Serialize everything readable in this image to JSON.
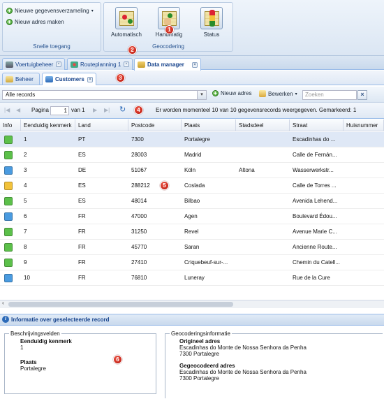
{
  "ribbon": {
    "quick_access": {
      "new_dataset_label": "Nieuwe gegevensverzameling",
      "new_address_label": "Nieuw adres maken",
      "group_label": "Snelle toegang"
    },
    "geocoding": {
      "automatic_label": "Automatisch",
      "manual_label": "Handmatig",
      "status_label": "Status",
      "group_label": "Geocodering"
    }
  },
  "tabs": [
    {
      "label": "Voertuigbeheer"
    },
    {
      "label": "Routeplanning 1"
    },
    {
      "label": "Data manager"
    }
  ],
  "subtabs": [
    {
      "label": "Beheer"
    },
    {
      "label": "Customers"
    }
  ],
  "toolbar": {
    "filter_value": "Alle records",
    "new_address_label": "Nieuw adres",
    "edit_label": "Bewerken",
    "search_placeholder": "Zoeken"
  },
  "pager": {
    "page_label": "Pagina",
    "page_value": "1",
    "of_label": "van 1",
    "status_text": "Er worden momenteel 10 van 10 gegevensrecords weergegeven. Gemarkeerd: 1"
  },
  "grid": {
    "columns": [
      "Info",
      "Eenduidig kenmerk",
      "Land",
      "Postcode",
      "Plaats",
      "Stadsdeel",
      "Straat",
      "Huisnummer"
    ],
    "rows": [
      {
        "status": "green",
        "id": "1",
        "land": "PT",
        "postcode": "7300",
        "plaats": "Portalegre",
        "stadsdeel": "",
        "straat": "Escadinhas do ...",
        "huisnummer": "",
        "selected": true
      },
      {
        "status": "green",
        "id": "2",
        "land": "ES",
        "postcode": "28003",
        "plaats": "Madrid",
        "stadsdeel": "",
        "straat": "Calle de Fernán...",
        "huisnummer": "",
        "selected": false
      },
      {
        "status": "blue",
        "id": "3",
        "land": "DE",
        "postcode": "51067",
        "plaats": "Köln",
        "stadsdeel": "Altona",
        "straat": "Wasserwerkstr...",
        "huisnummer": "",
        "selected": false
      },
      {
        "status": "yellow",
        "id": "4",
        "land": "ES",
        "postcode": "288212",
        "plaats": "Coslada",
        "stadsdeel": "",
        "straat": "Calle de Torres ...",
        "huisnummer": "",
        "selected": false
      },
      {
        "status": "green",
        "id": "5",
        "land": "ES",
        "postcode": "48014",
        "plaats": "Bilbao",
        "stadsdeel": "",
        "straat": "Avenida Lehend...",
        "huisnummer": "",
        "selected": false
      },
      {
        "status": "blue",
        "id": "6",
        "land": "FR",
        "postcode": "47000",
        "plaats": "Agen",
        "stadsdeel": "",
        "straat": "Boulevard Édou...",
        "huisnummer": "",
        "selected": false
      },
      {
        "status": "green",
        "id": "7",
        "land": "FR",
        "postcode": "31250",
        "plaats": "Revel",
        "stadsdeel": "",
        "straat": "Avenue Marie C...",
        "huisnummer": "",
        "selected": false
      },
      {
        "status": "green",
        "id": "8",
        "land": "FR",
        "postcode": "45770",
        "plaats": "Saran",
        "stadsdeel": "",
        "straat": "Ancienne Route...",
        "huisnummer": "",
        "selected": false
      },
      {
        "status": "green",
        "id": "9",
        "land": "FR",
        "postcode": "27410",
        "plaats": "Criquebeuf-sur-...",
        "stadsdeel": "",
        "straat": "Chemin du Catell...",
        "huisnummer": "",
        "selected": false
      },
      {
        "status": "blue",
        "id": "10",
        "land": "FR",
        "postcode": "76810",
        "plaats": "Luneray",
        "stadsdeel": "",
        "straat": "Rue de la Cure",
        "huisnummer": "",
        "selected": false
      }
    ]
  },
  "info": {
    "title": "Informatie over geselecteerde record",
    "desc_legend": "Beschrijvingsvelden",
    "id_label": "Eenduidig kenmerk",
    "id_value": "1",
    "place_label": "Plaats",
    "place_value": "Portalegre",
    "geo_legend": "Geocoderingsinformatie",
    "orig_label": "Origineel adres",
    "orig_line1": "Escadinhas do Monte de Nossa Senhora da Penha",
    "orig_line2": "7300 Portalegre",
    "geo_label": "Gegeocodeerd adres",
    "geo_line1": "Escadinhas do Monte de Nossa Senhora da Penha",
    "geo_line2": "7300 Portalegre"
  },
  "callouts": [
    "1",
    "2",
    "3",
    "4",
    "5",
    "6"
  ],
  "colors": {
    "green": "#5cc04a",
    "blue": "#4a9be0",
    "yellow": "#f2c23a",
    "accent": "#15428b",
    "callout": "#c8180c"
  }
}
